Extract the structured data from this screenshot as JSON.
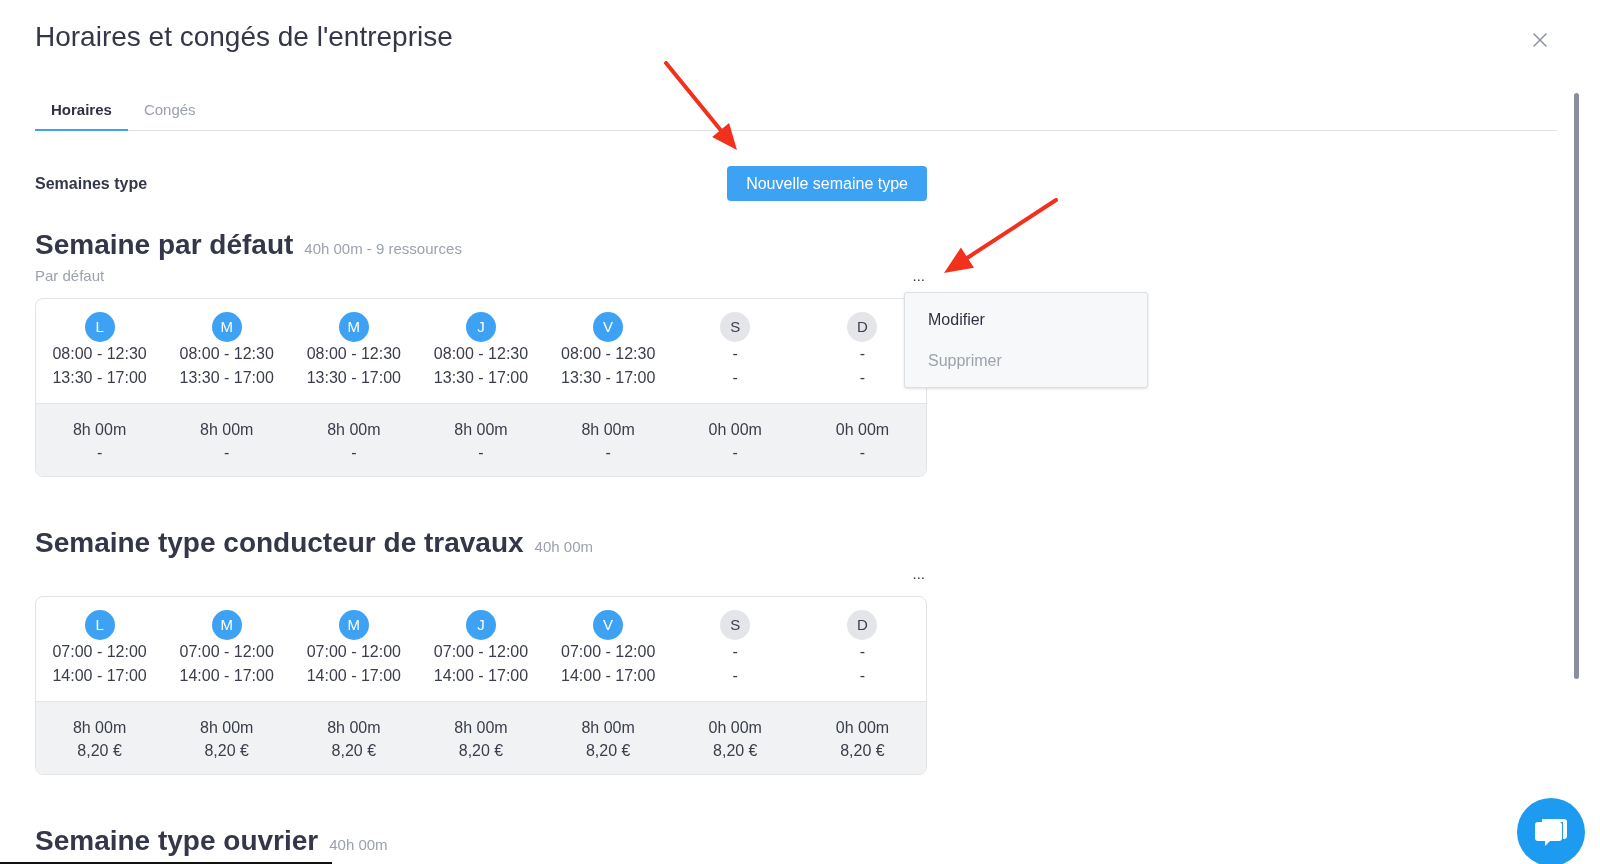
{
  "dialog": {
    "title": "Horaires et congés de l'entreprise"
  },
  "tabs": [
    {
      "label": "Horaires",
      "selected": true
    },
    {
      "label": "Congés",
      "selected": false
    }
  ],
  "toolbar": {
    "heading": "Semaines type",
    "button": "Nouvelle semaine type"
  },
  "weeks": [
    {
      "title": "Semaine par défaut",
      "summary": "40h 00m - 9 ressources",
      "note": "Par défaut",
      "more": "...",
      "menu": {
        "items": [
          {
            "label": "Modifier",
            "disabled": false
          },
          {
            "label": "Supprimer",
            "disabled": true
          }
        ]
      },
      "days": [
        {
          "letter": "L",
          "active": true,
          "slots": [
            "08:00 - 12:30",
            "13:30 - 17:00"
          ],
          "total": "8h 00m",
          "cost": "-"
        },
        {
          "letter": "M",
          "active": true,
          "slots": [
            "08:00 - 12:30",
            "13:30 - 17:00"
          ],
          "total": "8h 00m",
          "cost": "-"
        },
        {
          "letter": "M",
          "active": true,
          "slots": [
            "08:00 - 12:30",
            "13:30 - 17:00"
          ],
          "total": "8h 00m",
          "cost": "-"
        },
        {
          "letter": "J",
          "active": true,
          "slots": [
            "08:00 - 12:30",
            "13:30 - 17:00"
          ],
          "total": "8h 00m",
          "cost": "-"
        },
        {
          "letter": "V",
          "active": true,
          "slots": [
            "08:00 - 12:30",
            "13:30 - 17:00"
          ],
          "total": "8h 00m",
          "cost": "-"
        },
        {
          "letter": "S",
          "active": false,
          "slots": [
            "-",
            "-"
          ],
          "total": "0h 00m",
          "cost": "-"
        },
        {
          "letter": "D",
          "active": false,
          "slots": [
            "-",
            "-"
          ],
          "total": "0h 00m",
          "cost": "-"
        }
      ]
    },
    {
      "title": "Semaine type conducteur de travaux",
      "summary": "40h 00m",
      "more": "...",
      "days": [
        {
          "letter": "L",
          "active": true,
          "slots": [
            "07:00 - 12:00",
            "14:00 - 17:00"
          ],
          "total": "8h 00m",
          "cost": "8,20 €"
        },
        {
          "letter": "M",
          "active": true,
          "slots": [
            "07:00 - 12:00",
            "14:00 - 17:00"
          ],
          "total": "8h 00m",
          "cost": "8,20 €"
        },
        {
          "letter": "M",
          "active": true,
          "slots": [
            "07:00 - 12:00",
            "14:00 - 17:00"
          ],
          "total": "8h 00m",
          "cost": "8,20 €"
        },
        {
          "letter": "J",
          "active": true,
          "slots": [
            "07:00 - 12:00",
            "14:00 - 17:00"
          ],
          "total": "8h 00m",
          "cost": "8,20 €"
        },
        {
          "letter": "V",
          "active": true,
          "slots": [
            "07:00 - 12:00",
            "14:00 - 17:00"
          ],
          "total": "8h 00m",
          "cost": "8,20 €"
        },
        {
          "letter": "S",
          "active": false,
          "slots": [
            "-",
            "-"
          ],
          "total": "0h 00m",
          "cost": "8,20 €"
        },
        {
          "letter": "D",
          "active": false,
          "slots": [
            "-",
            "-"
          ],
          "total": "0h 00m",
          "cost": "8,20 €"
        }
      ]
    },
    {
      "title": "Semaine type ouvrier",
      "summary": "40h 00m"
    }
  ]
}
